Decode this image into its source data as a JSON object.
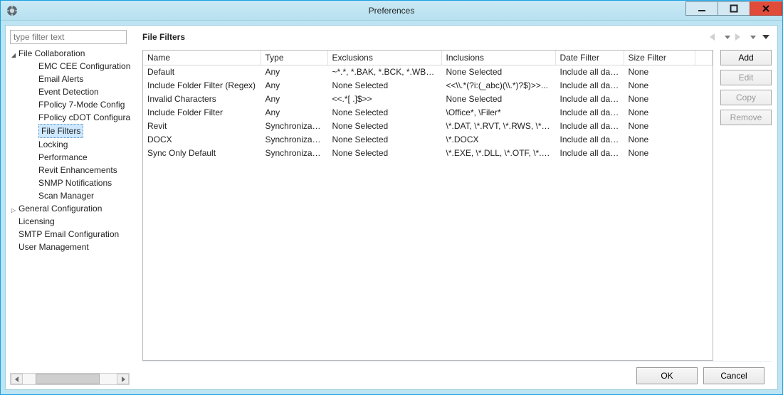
{
  "window": {
    "title": "Preferences"
  },
  "filter": {
    "placeholder": "type filter text"
  },
  "tree": {
    "items": [
      {
        "label": "File Collaboration",
        "level": 0,
        "exp": "▾"
      },
      {
        "label": "EMC CEE Configuration",
        "level": 1
      },
      {
        "label": "Email Alerts",
        "level": 1
      },
      {
        "label": "Event Detection",
        "level": 1
      },
      {
        "label": "FPolicy 7-Mode Config",
        "level": 1
      },
      {
        "label": "FPolicy cDOT Configura",
        "level": 1
      },
      {
        "label": "File Filters",
        "level": 1,
        "selected": true
      },
      {
        "label": "Locking",
        "level": 1
      },
      {
        "label": "Performance",
        "level": 1
      },
      {
        "label": "Revit Enhancements",
        "level": 1
      },
      {
        "label": "SNMP Notifications",
        "level": 1
      },
      {
        "label": "Scan Manager",
        "level": 1
      },
      {
        "label": "General Configuration",
        "level": 0,
        "exp": "▹"
      },
      {
        "label": "Licensing",
        "level": 0
      },
      {
        "label": "SMTP Email Configuration",
        "level": 0
      },
      {
        "label": "User Management",
        "level": 0
      }
    ]
  },
  "page": {
    "heading": "File Filters"
  },
  "columns": {
    "name": "Name",
    "type": "Type",
    "exc": "Exclusions",
    "inc": "Inclusions",
    "date": "Date Filter",
    "size": "Size Filter"
  },
  "rows": [
    {
      "name": "Default",
      "type": "Any",
      "exc": "~*.*, *.BAK, *.BCK, *.WBK, ...",
      "inc": "None Selected",
      "date": "Include all dates",
      "size": "None"
    },
    {
      "name": "Include Folder Filter (Regex)",
      "type": "Any",
      "exc": "None Selected",
      "inc": "<<\\\\.*(?i:(_abc)(\\\\.*)?$)>>...",
      "date": "Include all dates",
      "size": "None"
    },
    {
      "name": "Invalid Characters",
      "type": "Any",
      "exc": "<<.*[ .]$>>",
      "inc": "None Selected",
      "date": "Include all dates",
      "size": "None"
    },
    {
      "name": "Include Folder Filter",
      "type": "Any",
      "exc": "None Selected",
      "inc": "\\Office*, \\Filer*",
      "date": "Include all dates",
      "size": "None"
    },
    {
      "name": "Revit",
      "type": "Synchronizatio...",
      "exc": "None Selected",
      "inc": "\\*.DAT, \\*.RVT, \\*.RWS, \\*....",
      "date": "Include all dates",
      "size": "None"
    },
    {
      "name": "DOCX",
      "type": "Synchronizatio...",
      "exc": "None Selected",
      "inc": "\\*.DOCX",
      "date": "Include all dates",
      "size": "None"
    },
    {
      "name": "Sync Only Default",
      "type": "Synchronizatio...",
      "exc": "None Selected",
      "inc": "\\*.EXE, \\*.DLL, \\*.OTF, \\*.T...",
      "date": "Include all dates",
      "size": "None"
    }
  ],
  "buttons": {
    "add": "Add",
    "edit": "Edit",
    "copy": "Copy",
    "remove": "Remove",
    "ok": "OK",
    "cancel": "Cancel"
  }
}
